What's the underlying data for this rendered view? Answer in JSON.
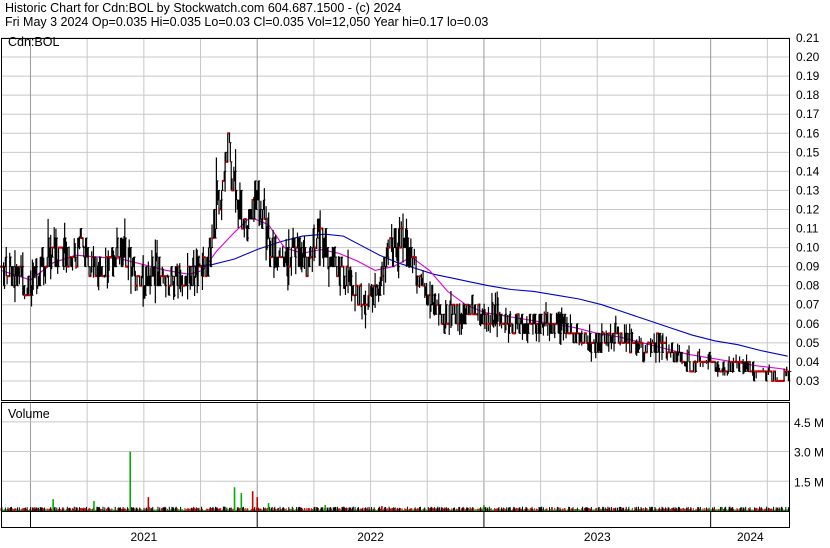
{
  "header": {
    "line1": "Historic Chart for Cdn:BOL by Stockwatch.com 604.687.1500 - (c) 2024",
    "line2": "Fri May  3 2024   Op=0.035  Hi=0.035  Lo=0.03  Cl=0.035  Vol=12,050  Year hi=0.17  lo=0.03"
  },
  "chart_data": [
    {
      "type": "ohlc",
      "title": "Cdn:BOL",
      "ylim": [
        0.02,
        0.21
      ],
      "yticks": [
        "0.03",
        "0.04",
        "0.05",
        "0.06",
        "0.07",
        "0.08",
        "0.09",
        "0.10",
        "0.11",
        "0.12",
        "0.13",
        "0.14",
        "0.15",
        "0.16",
        "0.17",
        "0.18",
        "0.19",
        "0.20",
        "0.21"
      ],
      "x_range": [
        2020.87,
        2024.35
      ],
      "xtick_labels": [
        "2021",
        "2022",
        "2023",
        "2024"
      ],
      "year_boundaries": [
        2021.0,
        2022.0,
        2023.0,
        2024.0
      ],
      "colors": {
        "bar": "#000000",
        "unchanged": "#cc0000",
        "ma_short": "#dd00dd",
        "ma_long": "#0000cc",
        "grid": "#c8c8c8"
      },
      "price_anchors": [
        [
          2020.87,
          0.09
        ],
        [
          2020.93,
          0.085
        ],
        [
          2021.0,
          0.08
        ],
        [
          2021.06,
          0.095
        ],
        [
          2021.12,
          0.1
        ],
        [
          2021.18,
          0.095
        ],
        [
          2021.22,
          0.1
        ],
        [
          2021.28,
          0.09
        ],
        [
          2021.34,
          0.09
        ],
        [
          2021.4,
          0.1
        ],
        [
          2021.45,
          0.09
        ],
        [
          2021.5,
          0.08
        ],
        [
          2021.55,
          0.09
        ],
        [
          2021.6,
          0.08
        ],
        [
          2021.66,
          0.085
        ],
        [
          2021.72,
          0.085
        ],
        [
          2021.78,
          0.09
        ],
        [
          2021.83,
          0.13
        ],
        [
          2021.87,
          0.15
        ],
        [
          2021.92,
          0.12
        ],
        [
          2021.96,
          0.11
        ],
        [
          2022.0,
          0.13
        ],
        [
          2022.05,
          0.1
        ],
        [
          2022.12,
          0.09
        ],
        [
          2022.18,
          0.1
        ],
        [
          2022.22,
          0.09
        ],
        [
          2022.26,
          0.11
        ],
        [
          2022.3,
          0.1
        ],
        [
          2022.36,
          0.09
        ],
        [
          2022.42,
          0.08
        ],
        [
          2022.48,
          0.07
        ],
        [
          2022.54,
          0.08
        ],
        [
          2022.58,
          0.1
        ],
        [
          2022.66,
          0.1
        ],
        [
          2022.72,
          0.08
        ],
        [
          2022.78,
          0.07
        ],
        [
          2022.82,
          0.06
        ],
        [
          2022.86,
          0.07
        ],
        [
          2022.9,
          0.06
        ],
        [
          2022.94,
          0.07
        ],
        [
          2023.0,
          0.06
        ],
        [
          2023.06,
          0.065
        ],
        [
          2023.12,
          0.06
        ],
        [
          2023.2,
          0.06
        ],
        [
          2023.28,
          0.06
        ],
        [
          2023.34,
          0.06
        ],
        [
          2023.4,
          0.055
        ],
        [
          2023.46,
          0.05
        ],
        [
          2023.52,
          0.05
        ],
        [
          2023.58,
          0.055
        ],
        [
          2023.64,
          0.05
        ],
        [
          2023.7,
          0.045
        ],
        [
          2023.76,
          0.05
        ],
        [
          2023.82,
          0.045
        ],
        [
          2023.88,
          0.04
        ],
        [
          2023.94,
          0.04
        ],
        [
          2024.0,
          0.04
        ],
        [
          2024.06,
          0.035
        ],
        [
          2024.12,
          0.04
        ],
        [
          2024.18,
          0.035
        ],
        [
          2024.24,
          0.035
        ],
        [
          2024.3,
          0.03
        ],
        [
          2024.34,
          0.035
        ]
      ],
      "ma_short": [
        [
          2020.87,
          0.088
        ],
        [
          2021.0,
          0.083
        ],
        [
          2021.1,
          0.092
        ],
        [
          2021.2,
          0.096
        ],
        [
          2021.3,
          0.095
        ],
        [
          2021.4,
          0.094
        ],
        [
          2021.5,
          0.091
        ],
        [
          2021.6,
          0.088
        ],
        [
          2021.7,
          0.086
        ],
        [
          2021.76,
          0.088
        ],
        [
          2021.82,
          0.098
        ],
        [
          2021.9,
          0.108
        ],
        [
          2021.97,
          0.116
        ],
        [
          2022.05,
          0.112
        ],
        [
          2022.12,
          0.1
        ],
        [
          2022.2,
          0.097
        ],
        [
          2022.28,
          0.099
        ],
        [
          2022.36,
          0.097
        ],
        [
          2022.44,
          0.093
        ],
        [
          2022.52,
          0.088
        ],
        [
          2022.6,
          0.09
        ],
        [
          2022.68,
          0.095
        ],
        [
          2022.76,
          0.088
        ],
        [
          2022.84,
          0.077
        ],
        [
          2022.92,
          0.07
        ],
        [
          2023.0,
          0.066
        ],
        [
          2023.1,
          0.064
        ],
        [
          2023.2,
          0.062
        ],
        [
          2023.3,
          0.06
        ],
        [
          2023.4,
          0.058
        ],
        [
          2023.5,
          0.055
        ],
        [
          2023.6,
          0.053
        ],
        [
          2023.7,
          0.05
        ],
        [
          2023.8,
          0.047
        ],
        [
          2023.9,
          0.044
        ],
        [
          2024.0,
          0.042
        ],
        [
          2024.1,
          0.04
        ],
        [
          2024.2,
          0.038
        ],
        [
          2024.34,
          0.036
        ]
      ],
      "ma_long": [
        [
          2021.7,
          0.09
        ],
        [
          2021.8,
          0.091
        ],
        [
          2021.9,
          0.094
        ],
        [
          2022.0,
          0.099
        ],
        [
          2022.1,
          0.103
        ],
        [
          2022.2,
          0.106
        ],
        [
          2022.3,
          0.107
        ],
        [
          2022.38,
          0.106
        ],
        [
          2022.46,
          0.101
        ],
        [
          2022.54,
          0.096
        ],
        [
          2022.62,
          0.092
        ],
        [
          2022.7,
          0.089
        ],
        [
          2022.78,
          0.086
        ],
        [
          2022.86,
          0.084
        ],
        [
          2022.94,
          0.082
        ],
        [
          2023.02,
          0.08
        ],
        [
          2023.12,
          0.078
        ],
        [
          2023.22,
          0.077
        ],
        [
          2023.32,
          0.075
        ],
        [
          2023.42,
          0.073
        ],
        [
          2023.52,
          0.07
        ],
        [
          2023.62,
          0.066
        ],
        [
          2023.72,
          0.062
        ],
        [
          2023.82,
          0.058
        ],
        [
          2023.92,
          0.054
        ],
        [
          2024.02,
          0.051
        ],
        [
          2024.12,
          0.049
        ],
        [
          2024.22,
          0.046
        ],
        [
          2024.34,
          0.043
        ]
      ]
    },
    {
      "type": "bar",
      "title": "Volume",
      "ylim": [
        0,
        5500000
      ],
      "ytick_labels": [
        "1.5 M",
        "3.0 M",
        "4.5 M"
      ],
      "ytick_values": [
        1500000,
        3000000,
        4500000
      ],
      "colors": {
        "up": "#00aa00",
        "down": "#cc0000",
        "flat": "#000000"
      },
      "spikes": [
        [
          2021.44,
          3000000,
          "up"
        ],
        [
          2021.52,
          700000,
          "down"
        ],
        [
          2021.28,
          500000,
          "up"
        ],
        [
          2021.1,
          600000,
          "up"
        ],
        [
          2021.9,
          1200000,
          "up"
        ],
        [
          2021.93,
          900000,
          "up"
        ],
        [
          2021.98,
          1000000,
          "down"
        ],
        [
          2022.0,
          700000,
          "down"
        ],
        [
          2022.05,
          400000,
          "up"
        ],
        [
          2022.3,
          300000,
          "up"
        ],
        [
          2022.55,
          250000,
          "down"
        ],
        [
          2023.0,
          300000,
          "up"
        ],
        [
          2023.3,
          200000,
          "down"
        ],
        [
          2024.05,
          200000,
          "up"
        ],
        [
          2024.2,
          150000,
          "down"
        ]
      ]
    }
  ]
}
